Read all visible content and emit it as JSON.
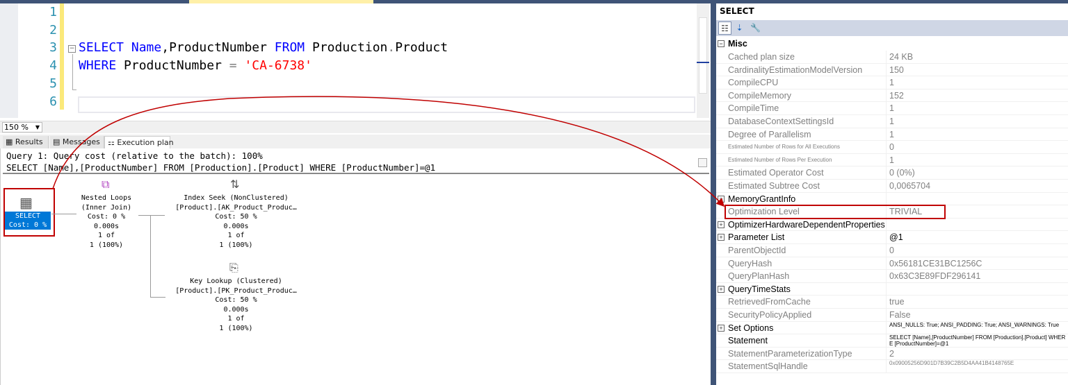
{
  "editor": {
    "line_numbers": [
      "1",
      "2",
      "3",
      "4",
      "5",
      "6"
    ],
    "line3": {
      "kw1": "SELECT",
      "col1": "Name",
      "rest1": ",ProductNumber ",
      "kw2": "FROM",
      "rest2": " Production",
      "dot": ".",
      "rest3": "Product"
    },
    "line4": {
      "kw": "WHERE",
      "rest": " ProductNumber ",
      "op": "=",
      "str": "'CA-6738'"
    }
  },
  "zoom": {
    "value": "150 %"
  },
  "result_tabs": [
    {
      "label": "Results",
      "icon": "grid-icon"
    },
    {
      "label": "Messages",
      "icon": "messages-icon"
    },
    {
      "label": "Execution plan",
      "icon": "plan-icon",
      "active": true
    }
  ],
  "plan": {
    "header1": "Query 1: Query cost (relative to the batch): 100%",
    "header2": "SELECT [Name],[ProductNumber] FROM [Production].[Product] WHERE [ProductNumber]=@1",
    "select_node": {
      "name": "SELECT",
      "cost": "Cost: 0 %"
    },
    "nested_loops": {
      "name": "Nested Loops",
      "sub": "(Inner Join)",
      "cost": "Cost: 0 %",
      "time": "0.000s",
      "rows1": "1 of",
      "rows2": "1 (100%)"
    },
    "index_seek": {
      "name": "Index Seek (NonClustered)",
      "sub": "[Product].[AK_Product_Produc…",
      "cost": "Cost: 50 %",
      "time": "0.000s",
      "rows1": "1 of",
      "rows2": "1 (100%)"
    },
    "key_lookup": {
      "name": "Key Lookup (Clustered)",
      "sub": "[Product].[PK_Product_Produc…",
      "cost": "Cost: 50 %",
      "time": "0.000s",
      "rows1": "1 of",
      "rows2": "1 (100%)"
    }
  },
  "properties": {
    "title": "SELECT",
    "category": "Misc",
    "rows": [
      {
        "name": "Cached plan size",
        "value": "24 KB"
      },
      {
        "name": "CardinalityEstimationModelVersion",
        "value": "150"
      },
      {
        "name": "CompileCPU",
        "value": "1"
      },
      {
        "name": "CompileMemory",
        "value": "152"
      },
      {
        "name": "CompileTime",
        "value": "1"
      },
      {
        "name": "DatabaseContextSettingsId",
        "value": "1"
      },
      {
        "name": "Degree of Parallelism",
        "value": "1"
      },
      {
        "name": "Estimated Number of Rows for All Executions",
        "value": "0"
      },
      {
        "name": "Estimated Number of Rows Per Execution",
        "value": "1"
      },
      {
        "name": "Estimated Operator Cost",
        "value": "0 (0%)"
      },
      {
        "name": "Estimated Subtree Cost",
        "value": "0,0065704"
      },
      {
        "name": "MemoryGrantInfo",
        "value": "",
        "expandable": true
      },
      {
        "name": "Optimization Level",
        "value": "TRIVIAL"
      },
      {
        "name": "OptimizerHardwareDependentProperties",
        "value": "",
        "expandable": true
      },
      {
        "name": "Parameter List",
        "value": "@1",
        "expandable": true
      },
      {
        "name": "ParentObjectId",
        "value": "0"
      },
      {
        "name": "QueryHash",
        "value": "0x56181CE31BC1256C"
      },
      {
        "name": "QueryPlanHash",
        "value": "0x63C3E89FDF296141"
      },
      {
        "name": "QueryTimeStats",
        "value": "",
        "expandable": true
      },
      {
        "name": "RetrievedFromCache",
        "value": "true"
      },
      {
        "name": "SecurityPolicyApplied",
        "value": "False"
      },
      {
        "name": "Set Options",
        "value": "ANSI_NULLS: True; ANSI_PADDING: True; ANSI_WARNINGS: True",
        "expandable": true
      },
      {
        "name": "Statement",
        "value": "SELECT [Name],[ProductNumber] FROM [Production].[Product] WHERE [ProductNumber]=@1",
        "bold": true
      },
      {
        "name": "StatementParameterizationType",
        "value": "2"
      },
      {
        "name": "StatementSqlHandle",
        "value": "0x09005256D901D7B39C2B5D4AA41B4148765E"
      }
    ]
  },
  "colors": {
    "accent": "#0078d7",
    "highlight": "#c00000",
    "keyword": "#0000ff",
    "string": "#ff0000"
  }
}
